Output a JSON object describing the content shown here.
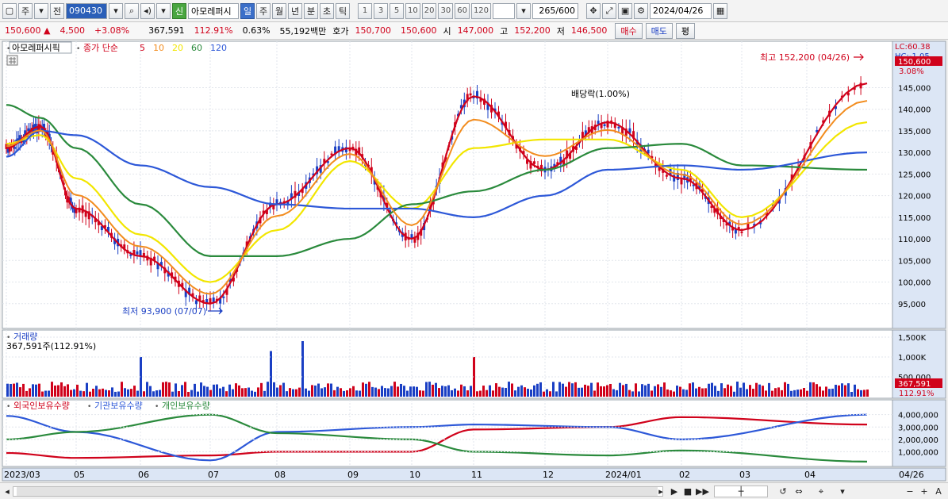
{
  "toolbar": {
    "market_label": "주",
    "period_label": "전",
    "code": "090430",
    "new_label": "신",
    "stock_name": "아모레퍼시",
    "tabs": [
      "일",
      "주",
      "월",
      "년",
      "분",
      "초",
      "틱"
    ],
    "active_tab": "일",
    "numbers": [
      "1",
      "3",
      "5",
      "10",
      "20",
      "30",
      "60",
      "120"
    ],
    "counter": "265",
    "counter_total": "/600",
    "date": "2024/04/26"
  },
  "quote": {
    "price": "150,600",
    "change_arrow": "▲",
    "change": "4,500",
    "change_pct": "+3.08%",
    "volume": "367,591",
    "volume_pct": "112.91%",
    "turnover_pct": "0.63%",
    "amount": "55,192백만",
    "ask_label": "호가",
    "ask": "150,700",
    "bid": "150,600",
    "open_label": "시",
    "open": "147,000",
    "high_label": "고",
    "high": "152,200",
    "low_label": "저",
    "low": "146,500",
    "buy_label": "매수",
    "sell_label": "매도",
    "eval_label": "평"
  },
  "price_panel": {
    "title": "아모레퍼시픽",
    "legend_prefix": "종가 단순",
    "ma_labels": [
      "5",
      "10",
      "20",
      "60",
      "120"
    ],
    "ma_colors": [
      "#d0021b",
      "#f28c1e",
      "#f2e600",
      "#2a8a3c",
      "#2d58d8"
    ],
    "lc_label": "LC:60.38",
    "hc_label": "HC:-1.05",
    "current_price_tag": "150,600",
    "current_pct_tag": "3.08%",
    "high_annotation": "최고 152,200 (04/26)",
    "low_annotation": "최저 93,900 (07/07)",
    "dividend_annotation": "배당락(1.00%)"
  },
  "volume_panel": {
    "title": "거래량",
    "subtitle": "367,591주(112.91%)",
    "current_tag": "367,591",
    "current_pct_tag": "112.91%"
  },
  "holding_panel": {
    "legend": [
      "외국인보유수량",
      "기관보유수량",
      "개인보유수량"
    ]
  },
  "xaxis": {
    "labels": [
      "2023/03",
      "05",
      "06",
      "07",
      "08",
      "09",
      "10",
      "11",
      "12",
      "2024/01",
      "02",
      "03",
      "04"
    ],
    "end_label": "04/26"
  },
  "chart_data": [
    {
      "type": "line",
      "title": "아모레퍼시픽",
      "subtitle": "종가 단순 5 10 20 60 120",
      "x_range": [
        "2023/03",
        "2024/04/26"
      ],
      "ylim": [
        90000,
        155000
      ],
      "y_ticks": [
        95000,
        100000,
        105000,
        110000,
        115000,
        120000,
        125000,
        130000,
        135000,
        140000,
        145000
      ],
      "y_tick_labels": [
        "95,000",
        "100,000",
        "105,000",
        "110,000",
        "115,000",
        "120,000",
        "125,000",
        "130,000",
        "135,000",
        "140,000",
        "145,000"
      ],
      "series": [
        {
          "name": "5",
          "color": "#d0021b",
          "x": [
            "2023/03",
            "2023/04",
            "2023/05",
            "2023/06",
            "2023/07",
            "2023/08",
            "2023/09",
            "2023/10",
            "2023/11",
            "2023/12",
            "2024/01",
            "2024/02",
            "2024/03",
            "2024/04/26"
          ],
          "values": [
            131000,
            136000,
            117000,
            106000,
            95000,
            118000,
            131000,
            110000,
            143000,
            126000,
            137000,
            124000,
            112000,
            146000
          ]
        },
        {
          "name": "20",
          "color": "#f2e600",
          "x": [
            "2023/03",
            "2023/04",
            "2023/05",
            "2023/06",
            "2023/07",
            "2023/08",
            "2023/09",
            "2023/10",
            "2023/11",
            "2023/12",
            "2024/01",
            "2024/02",
            "2024/03",
            "2024/04/26"
          ],
          "values": [
            132000,
            134000,
            124000,
            111000,
            100000,
            112000,
            128000,
            117000,
            131000,
            133000,
            133000,
            126000,
            115000,
            137000
          ]
        },
        {
          "name": "60",
          "color": "#2a8a3c",
          "x": [
            "2023/03",
            "2023/04",
            "2023/05",
            "2023/06",
            "2023/07",
            "2023/08",
            "2023/09",
            "2023/10",
            "2023/11",
            "2023/12",
            "2024/01",
            "2024/02",
            "2024/03",
            "2024/04/26"
          ],
          "values": [
            141000,
            138000,
            131000,
            118000,
            106000,
            106000,
            110000,
            118000,
            121000,
            126000,
            131000,
            132000,
            127000,
            126000
          ]
        },
        {
          "name": "120",
          "color": "#2d58d8",
          "x": [
            "2023/03",
            "2023/04",
            "2023/05",
            "2023/06",
            "2023/07",
            "2023/08",
            "2023/09",
            "2023/10",
            "2023/11",
            "2023/12",
            "2024/01",
            "2024/02",
            "2024/03",
            "2024/04/26"
          ],
          "values": [
            129000,
            135000,
            134000,
            127000,
            122000,
            118000,
            117000,
            117000,
            115000,
            120000,
            126000,
            127000,
            126000,
            130000
          ]
        }
      ],
      "annotations": [
        "최고 152,200 (04/26)",
        "최저 93,900 (07/07)",
        "배당락(1.00%)"
      ]
    },
    {
      "type": "bar",
      "title": "거래량",
      "subtitle": "367,591주(112.91%)",
      "ylim": [
        0,
        1600000
      ],
      "y_ticks": [
        500000,
        1000000,
        1500000
      ],
      "y_tick_labels": [
        "500,000",
        "1,000K",
        "1,500K"
      ],
      "notable_values": [
        {
          "x": "2023/07/말",
          "value": 1150000
        },
        {
          "x": "2023/08/중",
          "value": 1400000
        },
        {
          "x": "2023/06",
          "value": 1000000
        },
        {
          "x": "2023/11",
          "value": 1000000
        }
      ],
      "latest_value": 367591
    },
    {
      "type": "line",
      "title": "",
      "ylim": [
        0,
        4300000
      ],
      "y_ticks": [
        1000000,
        2000000,
        3000000,
        4000000
      ],
      "y_tick_labels": [
        "1,000,000",
        "2,000,000",
        "3,000,000",
        "4,000,000"
      ],
      "series": [
        {
          "name": "외국인보유수량",
          "color": "#d0021b",
          "x": [
            "2023/03",
            "2023/05",
            "2023/07",
            "2023/08",
            "2023/10",
            "2023/11",
            "2024/01",
            "2024/02",
            "2024/04/26"
          ],
          "values": [
            900000,
            500000,
            700000,
            1000000,
            1000000,
            2800000,
            3000000,
            3800000,
            3200000
          ]
        },
        {
          "name": "기관보유수량",
          "color": "#2d58d8",
          "x": [
            "2023/03",
            "2023/05",
            "2023/07",
            "2023/08",
            "2023/10",
            "2023/11",
            "2024/01",
            "2024/02",
            "2024/04/26"
          ],
          "values": [
            3900000,
            2600000,
            300000,
            2600000,
            3000000,
            3200000,
            3000000,
            2000000,
            4000000
          ]
        },
        {
          "name": "개인보유수량",
          "color": "#2a8a3c",
          "x": [
            "2023/03",
            "2023/05",
            "2023/07",
            "2023/08",
            "2023/10",
            "2023/11",
            "2024/01",
            "2024/02",
            "2024/04/26"
          ],
          "values": [
            2000000,
            2600000,
            4000000,
            2500000,
            2000000,
            1000000,
            700000,
            1100000,
            200000
          ]
        }
      ]
    }
  ]
}
